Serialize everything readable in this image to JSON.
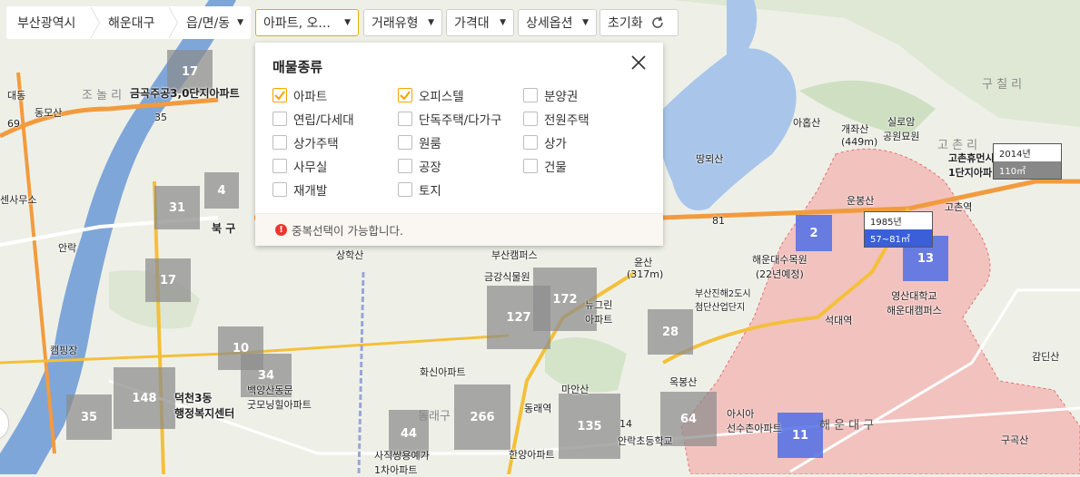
{
  "breadcrumb": {
    "city": "부산광역시",
    "district": "해운대구",
    "dong": "읍/면/동"
  },
  "filters": {
    "property_type": "아파트, 오...",
    "deal_type": "거래유형",
    "price": "가격대",
    "detail": "상세옵션",
    "reset": "초기화"
  },
  "panel": {
    "title": "매물종류",
    "options": [
      {
        "label": "아파트",
        "checked": true
      },
      {
        "label": "오피스텔",
        "checked": true
      },
      {
        "label": "분양권",
        "checked": false
      },
      {
        "label": "연립/다세대",
        "checked": false
      },
      {
        "label": "단독주택/다가구",
        "checked": false
      },
      {
        "label": "전원주택",
        "checked": false
      },
      {
        "label": "상가주택",
        "checked": false
      },
      {
        "label": "원룸",
        "checked": false
      },
      {
        "label": "상가",
        "checked": false
      },
      {
        "label": "사무실",
        "checked": false
      },
      {
        "label": "공장",
        "checked": false
      },
      {
        "label": "건물",
        "checked": false
      },
      {
        "label": "재개발",
        "checked": false
      },
      {
        "label": "토지",
        "checked": false
      }
    ],
    "notice": "중복선택이 가능합니다."
  },
  "clusters": [
    {
      "count": "17",
      "style": "gray"
    },
    {
      "count": "4",
      "style": "gray"
    },
    {
      "count": "31",
      "style": "gray"
    },
    {
      "count": "17",
      "style": "gray"
    },
    {
      "count": "10",
      "style": "gray"
    },
    {
      "count": "34",
      "style": "gray"
    },
    {
      "count": "148",
      "style": "gray"
    },
    {
      "count": "35",
      "style": "gray"
    },
    {
      "count": "172",
      "style": "gray"
    },
    {
      "count": "127",
      "style": "gray"
    },
    {
      "count": "28",
      "style": "gray"
    },
    {
      "count": "266",
      "style": "gray"
    },
    {
      "count": "44",
      "style": "gray"
    },
    {
      "count": "135",
      "style": "gray"
    },
    {
      "count": "64",
      "style": "gray"
    },
    {
      "count": "2",
      "style": "blue"
    },
    {
      "count": "13",
      "style": "blue"
    },
    {
      "count": "11",
      "style": "blue"
    }
  ],
  "tooltips": [
    {
      "year": "1985년",
      "area": "57~81㎡"
    },
    {
      "year": "2014년",
      "area": "110㎡"
    }
  ],
  "map_labels": {
    "l1": "금곡주공3,0단지아파트",
    "l2": "조 놀 리",
    "l3": "동모산",
    "l4": "대동",
    "l5": "69",
    "l6": "35",
    "l7": "북 구",
    "l8": "안락",
    "l9": "상학산",
    "l10": "부산캠퍼스",
    "l11": "금강식물원",
    "l12": "윤산",
    "l13": "(317m)",
    "l14": "뉴그린\n아파트",
    "l15": "화신아파트",
    "l16": "덕천3동\n행정복지센터",
    "l17": "백양산동문\n굿모닝힐아파트",
    "l18": "사직쌍용예가\n1차아파트",
    "l19": "동래역",
    "l20": "마안산",
    "l21": "한양아파트",
    "l22": "안락초등학교",
    "l23": "옥봉산",
    "l24": "아시아\n선수촌아파트",
    "l25": "해 운 대 구",
    "l26": "해운대수목원\n(22년예정)",
    "l27": "영산대학교\n해운대캠퍼스",
    "l28": "운봉산",
    "l29": "개좌산\n(449m)",
    "l30": "실로암\n공원묘원",
    "l31": "아홉산",
    "l32": "땅뫼산",
    "l33": "구 칠 리",
    "l34": "고 촌 리",
    "l35": "고촌휴먼시\n1단지아파",
    "l36": "구곡산",
    "l37": "감딘산",
    "l38": "81",
    "l39": "14",
    "l40": "캠핑장",
    "l41": "석대역",
    "l42": "고촌역",
    "l43": "센사무소",
    "l44": "동래구",
    "l45": "부산진해2도시\n첨단산업단지"
  },
  "colors": {
    "accent": "#f0a800",
    "river": "#7fa6d9",
    "highlight_area": "#f3b3b0",
    "cluster_blue": "#506ee6",
    "cluster_gray": "#8c8c8c"
  }
}
